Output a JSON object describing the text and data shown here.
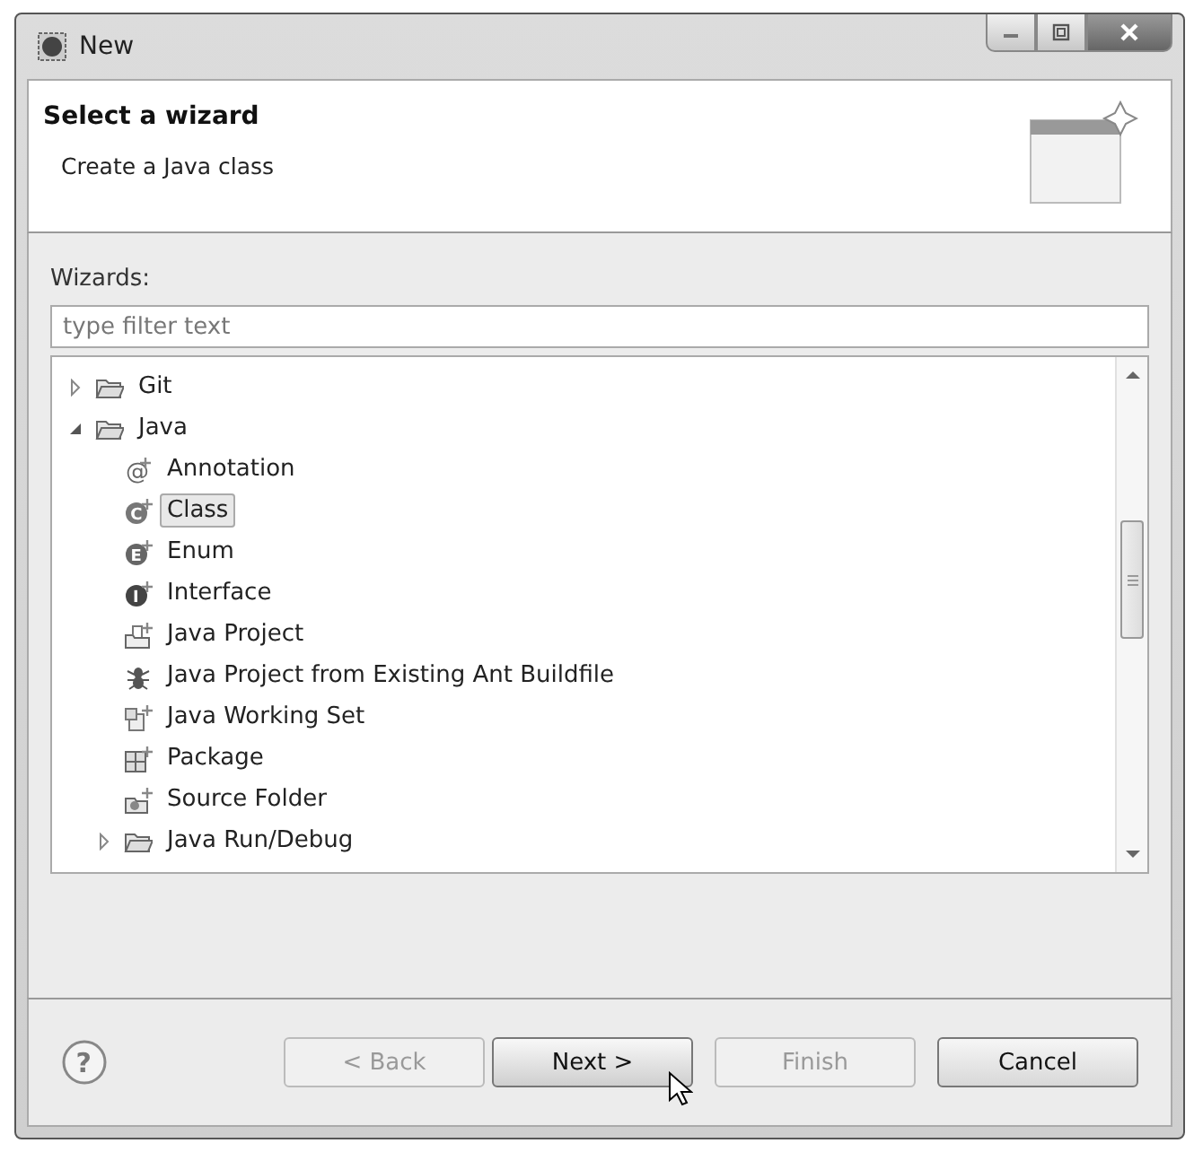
{
  "window": {
    "title": "New"
  },
  "header": {
    "title": "Select a wizard",
    "description": "Create a Java class"
  },
  "filter": {
    "label": "Wizards:",
    "placeholder": "type filter text"
  },
  "tree": [
    {
      "label": "Git",
      "kind": "folder",
      "expanded": false,
      "selected": false
    },
    {
      "label": "Java",
      "kind": "folder",
      "expanded": true,
      "selected": false,
      "children": [
        {
          "label": "Annotation",
          "kind": "annotation",
          "icon_text": "@",
          "selected": false
        },
        {
          "label": "Class",
          "kind": "class",
          "icon_text": "C",
          "selected": true
        },
        {
          "label": "Enum",
          "kind": "enum",
          "icon_text": "E",
          "selected": false
        },
        {
          "label": "Interface",
          "kind": "interface",
          "icon_text": "I",
          "selected": false
        },
        {
          "label": "Java Project",
          "kind": "project",
          "selected": false
        },
        {
          "label": "Java Project from Existing Ant Buildfile",
          "kind": "ant",
          "selected": false
        },
        {
          "label": "Java Working Set",
          "kind": "workingset",
          "selected": false
        },
        {
          "label": "Package",
          "kind": "package",
          "selected": false
        },
        {
          "label": "Source Folder",
          "kind": "sourcefolder",
          "selected": false
        },
        {
          "label": "Java Run/Debug",
          "kind": "folder",
          "expanded": false,
          "selected": false
        }
      ]
    }
  ],
  "help": {
    "icon_text": "?"
  },
  "buttons": [
    {
      "label": "< Back",
      "disabled": true
    },
    {
      "label": "Next >",
      "disabled": false
    },
    {
      "label": "Finish",
      "disabled": true
    },
    {
      "label": "Cancel",
      "disabled": false
    }
  ]
}
